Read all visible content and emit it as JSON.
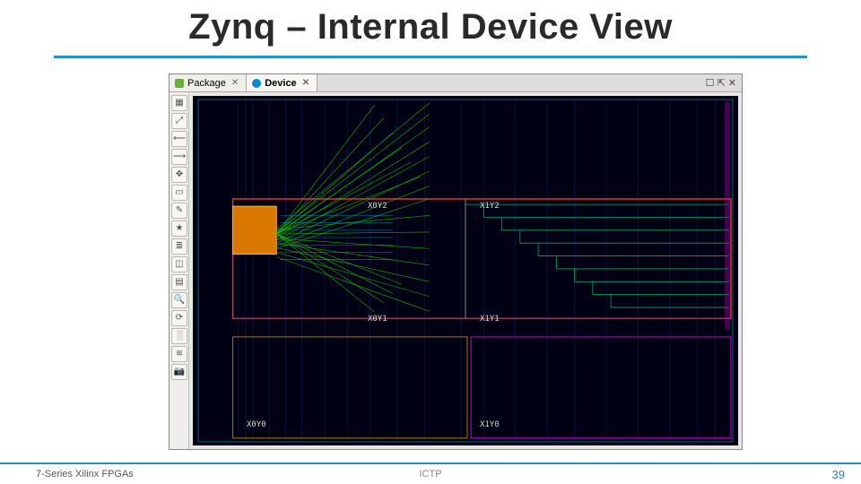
{
  "slide": {
    "title": "Zynq – Internal Device View"
  },
  "footer": {
    "left": "7-Series Xilinx FPGAs",
    "center": "ICTP",
    "page_number": "39"
  },
  "viewer": {
    "tabs": [
      {
        "label": "Package",
        "icon": "package-icon",
        "active": false
      },
      {
        "label": "Device",
        "icon": "device-icon",
        "active": true
      }
    ],
    "window_controls": "☐ ⇱ ✕",
    "toolbar_tips": [
      "toggle-minimap",
      "zoom-fit",
      "back",
      "forward",
      "select",
      "area-select",
      "measure",
      "highlight",
      "toggle-nets",
      "toggle-sites",
      "toggle-tiles",
      "find",
      "refresh",
      "congestion",
      "layers",
      "snapshot"
    ],
    "regions": {
      "x1y2": "X1Y2",
      "x0y2": "X0Y2",
      "x1y1": "X1Y1",
      "x0y1": "X0Y1",
      "x1y0": "X1Y0",
      "x0y0": "X0Y0"
    }
  }
}
